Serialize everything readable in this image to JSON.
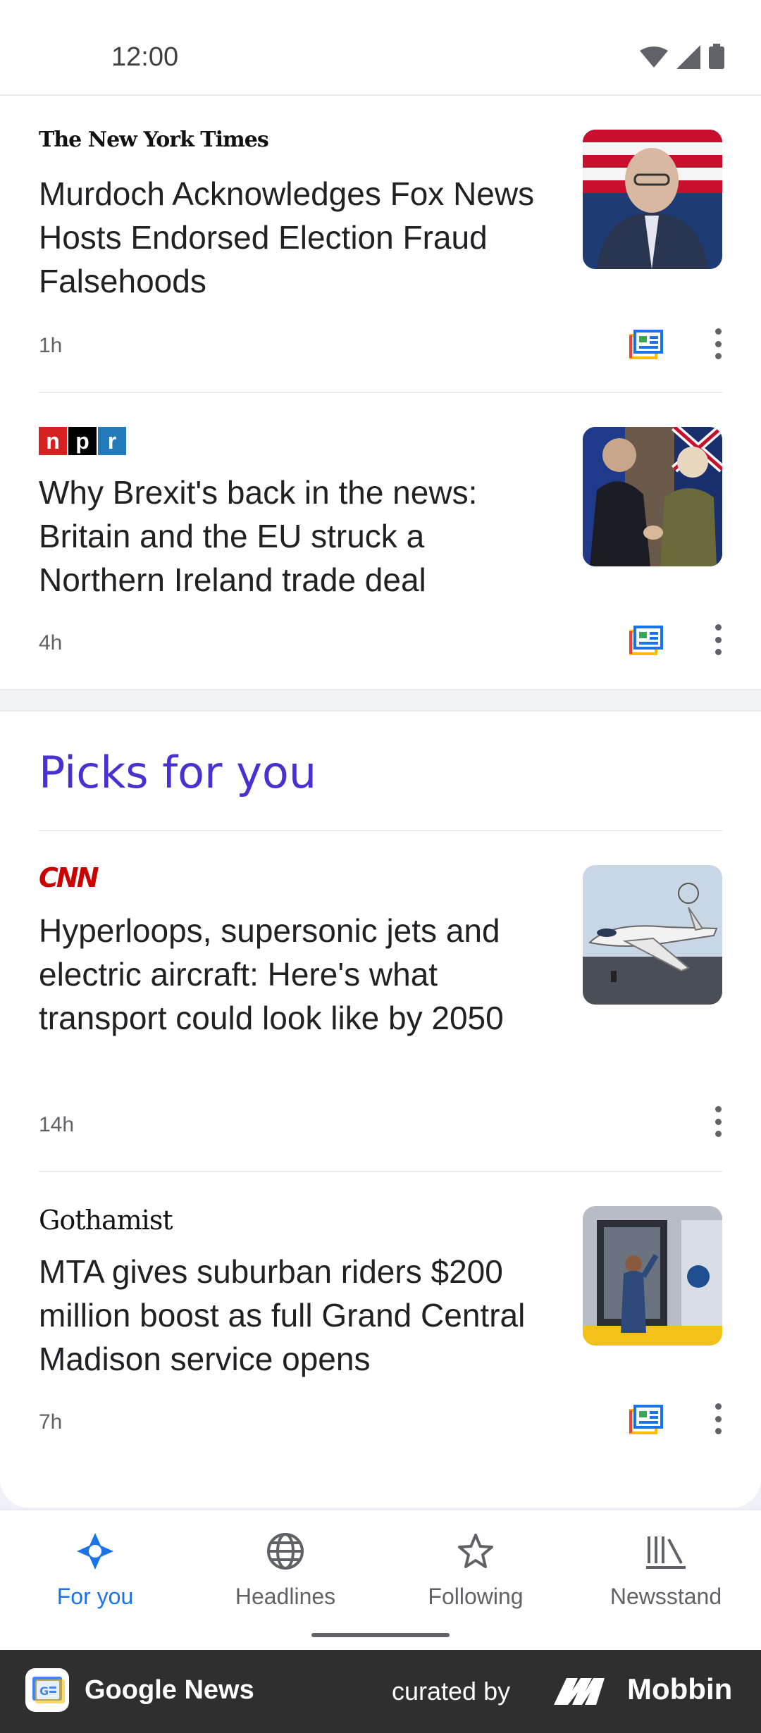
{
  "status_bar": {
    "time": "12:00"
  },
  "colors": {
    "accent": "#1a73e8",
    "section_title": "#4b2fd0",
    "cnn_red": "#cc0000",
    "npr_red": "#d62021",
    "npr_black": "#000000",
    "npr_blue": "#237bbd"
  },
  "articles_top": [
    {
      "source": "The New York Times",
      "headline": "Murdoch Acknowledges Fox News Hosts Endorsed Election Fraud Falsehoods",
      "time": "1h",
      "has_full_coverage": true
    },
    {
      "source_letters": [
        "n",
        "p",
        "r"
      ],
      "headline": "Why Brexit's back in the news: Britain and the EU struck a Northern Ireland trade deal",
      "time": "4h",
      "has_full_coverage": true
    }
  ],
  "section": {
    "title": "Picks for you"
  },
  "articles_picks": [
    {
      "source": "CNN",
      "headline": "Hyperloops, supersonic jets and electric aircraft: Here's what transport could look like by 2050",
      "time": "14h",
      "has_full_coverage": false
    },
    {
      "source": "Gothamist",
      "headline": "MTA gives suburban riders $200 million boost as full Grand Central Madison service opens",
      "time": "7h",
      "has_full_coverage": true
    }
  ],
  "bottom_nav": [
    {
      "label": "For you",
      "icon": "for-you-icon",
      "active": true
    },
    {
      "label": "Headlines",
      "icon": "globe-icon",
      "active": false
    },
    {
      "label": "Following",
      "icon": "star-icon",
      "active": false
    },
    {
      "label": "Newsstand",
      "icon": "newsstand-icon",
      "active": false
    }
  ],
  "footer": {
    "app_name": "Google News",
    "curated_by": "curated by",
    "brand": "Mobbin"
  }
}
